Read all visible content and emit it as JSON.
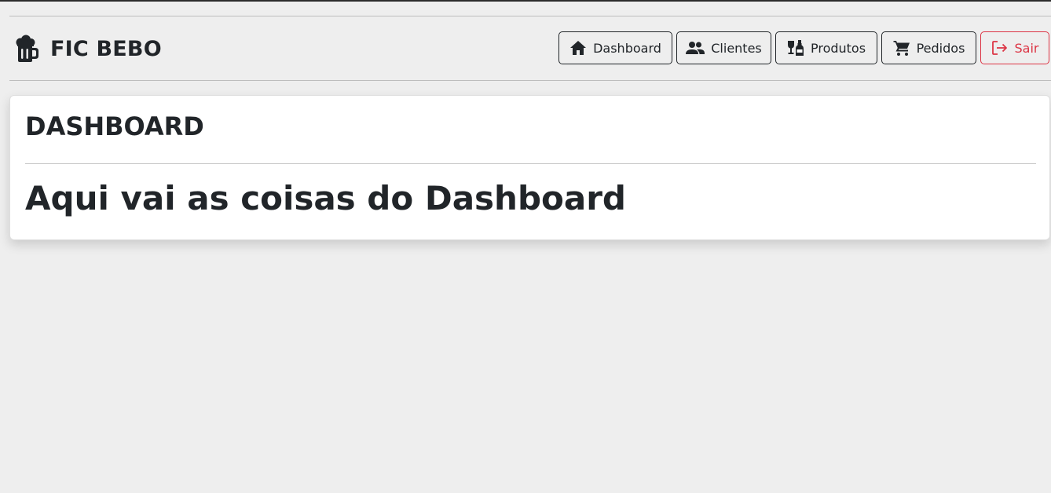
{
  "brand": {
    "name": "FIC BEBO",
    "icon": "beer-mug-icon"
  },
  "nav": {
    "dashboard": {
      "label": "Dashboard",
      "icon": "home-icon"
    },
    "clientes": {
      "label": "Clientes",
      "icon": "users-icon"
    },
    "produtos": {
      "label": "Produtos",
      "icon": "bottles-icon"
    },
    "pedidos": {
      "label": "Pedidos",
      "icon": "cart-icon"
    },
    "sair": {
      "label": "Sair",
      "icon": "logout-icon"
    }
  },
  "main": {
    "title": "DASHBOARD",
    "body": "Aqui vai as coisas do Dashboard"
  },
  "colors": {
    "background": "#eeeeee",
    "text": "#212529",
    "danger": "#dc3545",
    "card": "#ffffff"
  }
}
